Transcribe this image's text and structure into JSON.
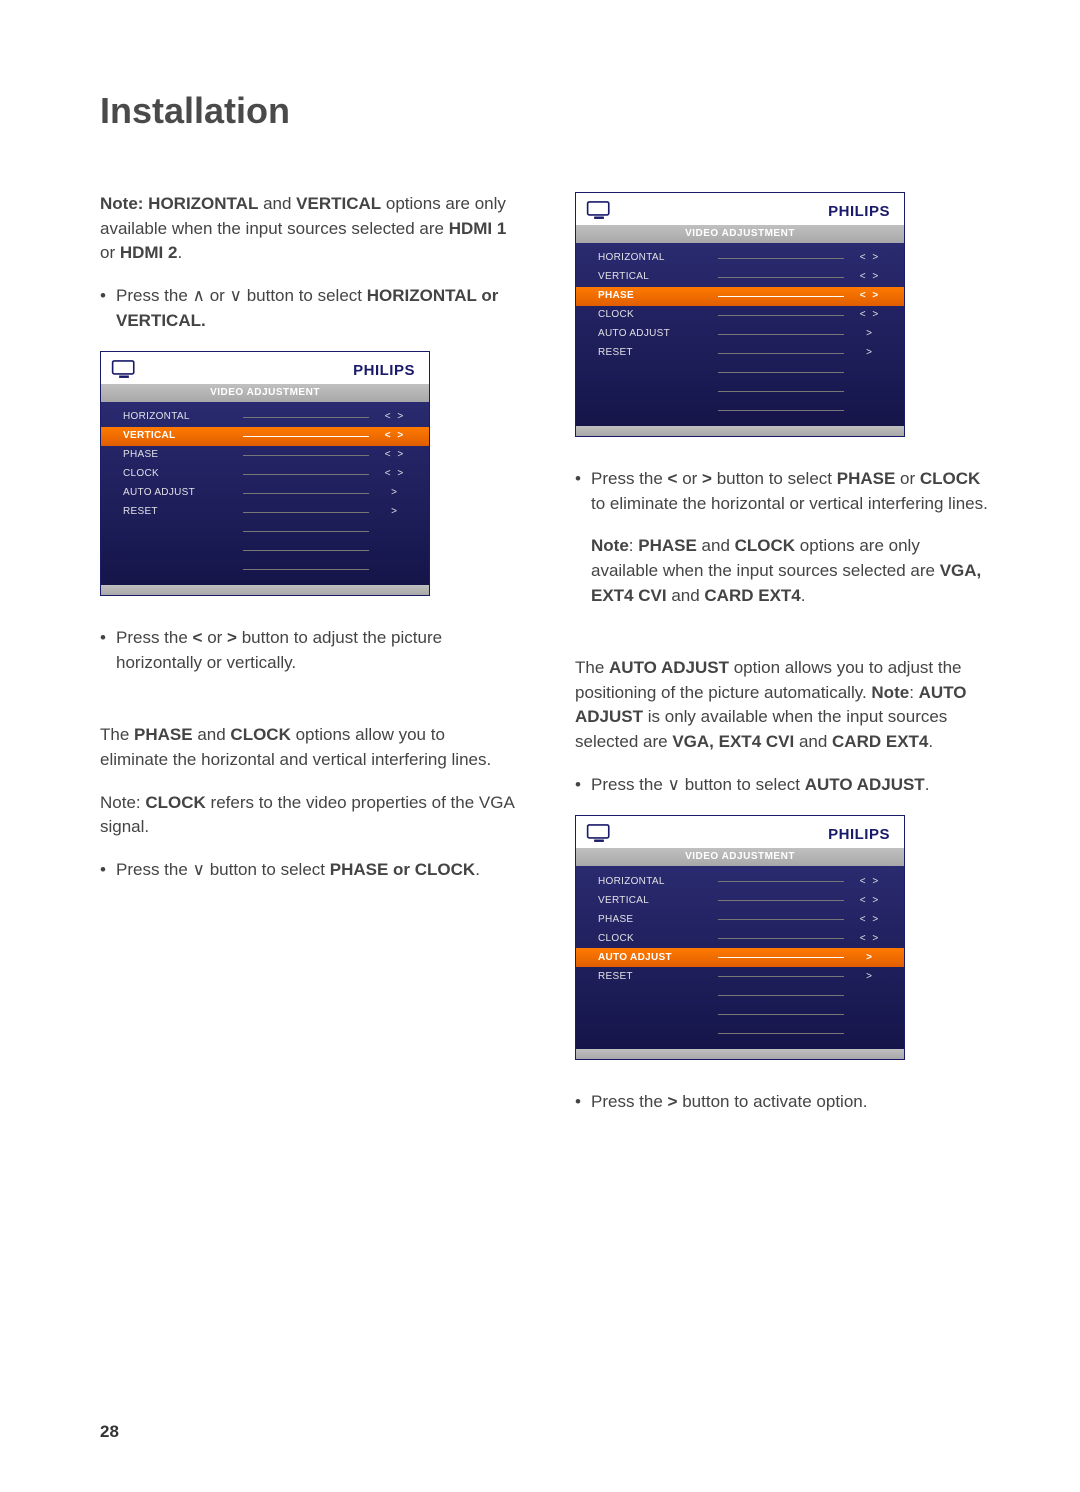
{
  "page": {
    "title": "Installation",
    "number": "28"
  },
  "left": {
    "note1_a": "Note: HORIZONTAL",
    "note1_b": " and ",
    "note1_c": "VERTICAL",
    "note1_d": " options are only available when the input sources selected are ",
    "note1_e": "HDMI 1",
    "note1_f": " or ",
    "note1_g": "HDMI 2",
    "note1_h": ".",
    "bullet1_a": "Press the  ∧ or ∨  button to select ",
    "bullet1_b": "HORIZONTAL or VERTICAL.",
    "bullet2_a": "Press the  ",
    "bullet2_b": "<",
    "bullet2_c": "  or  ",
    "bullet2_d": ">",
    "bullet2_e": "  button to adjust the picture horizontally or vertically.",
    "para2_a": "The ",
    "para2_b": "PHASE",
    "para2_c": " and ",
    "para2_d": "CLOCK",
    "para2_e": " options allow you to eliminate the horizontal and vertical interfering lines.",
    "para3_a": "Note: ",
    "para3_b": "CLOCK",
    "para3_c": " refers to the video properties of the VGA signal.",
    "bullet3_a": "Press the  ∨  button to select ",
    "bullet3_b": "PHASE or CLOCK",
    "bullet3_c": "."
  },
  "right": {
    "bullet1_a": "Press the  ",
    "bullet1_b": "<",
    "bullet1_c": "  or  ",
    "bullet1_d": ">",
    "bullet1_e": "  button to select ",
    "bullet1_f": "PHASE",
    "bullet1_g": " or ",
    "bullet1_h": "CLOCK",
    "bullet1_i": " to eliminate the horizontal or vertical interfering lines.",
    "note1_a": "Note",
    "note1_b": ": ",
    "note1_c": "PHASE",
    "note1_d": " and ",
    "note1_e": "CLOCK",
    "note1_f": " options are only available when the input sources selected are ",
    "note1_g": "VGA, EXT4 CVI",
    "note1_h": " and ",
    "note1_i": "CARD EXT4",
    "note1_j": ".",
    "para2_a": "The ",
    "para2_b": "AUTO ADJUST",
    "para2_c": " option allows you to adjust the positioning of the picture automatically. ",
    "para2_d": "Note",
    "para2_e": ": ",
    "para2_f": "AUTO ADJUST",
    "para2_g": " is only available when the input sources   selected are ",
    "para2_h": "VGA, EXT4 CVI",
    "para2_i": " and ",
    "para2_j": "CARD EXT4",
    "para2_k": ".",
    "bullet2_a": "Press the  ∨  button to select ",
    "bullet2_b": "AUTO ADJUST",
    "bullet2_c": ".",
    "bullet3_a": "Press the  ",
    "bullet3_b": ">",
    "bullet3_c": "  button to activate option."
  },
  "osd_common": {
    "brand": "PHILIPS",
    "title": "VIDEO ADJUSTMENT",
    "rows": [
      {
        "label": "HORIZONTAL",
        "ctrl": "<  >"
      },
      {
        "label": "VERTICAL",
        "ctrl": "<  >"
      },
      {
        "label": "PHASE",
        "ctrl": "<  >"
      },
      {
        "label": "CLOCK",
        "ctrl": "<  >"
      },
      {
        "label": "AUTO ADJUST",
        "ctrl": ">"
      },
      {
        "label": "RESET",
        "ctrl": ">"
      }
    ]
  },
  "osd1_highlight": 1,
  "osd2_highlight": 2,
  "osd3_highlight": 4
}
